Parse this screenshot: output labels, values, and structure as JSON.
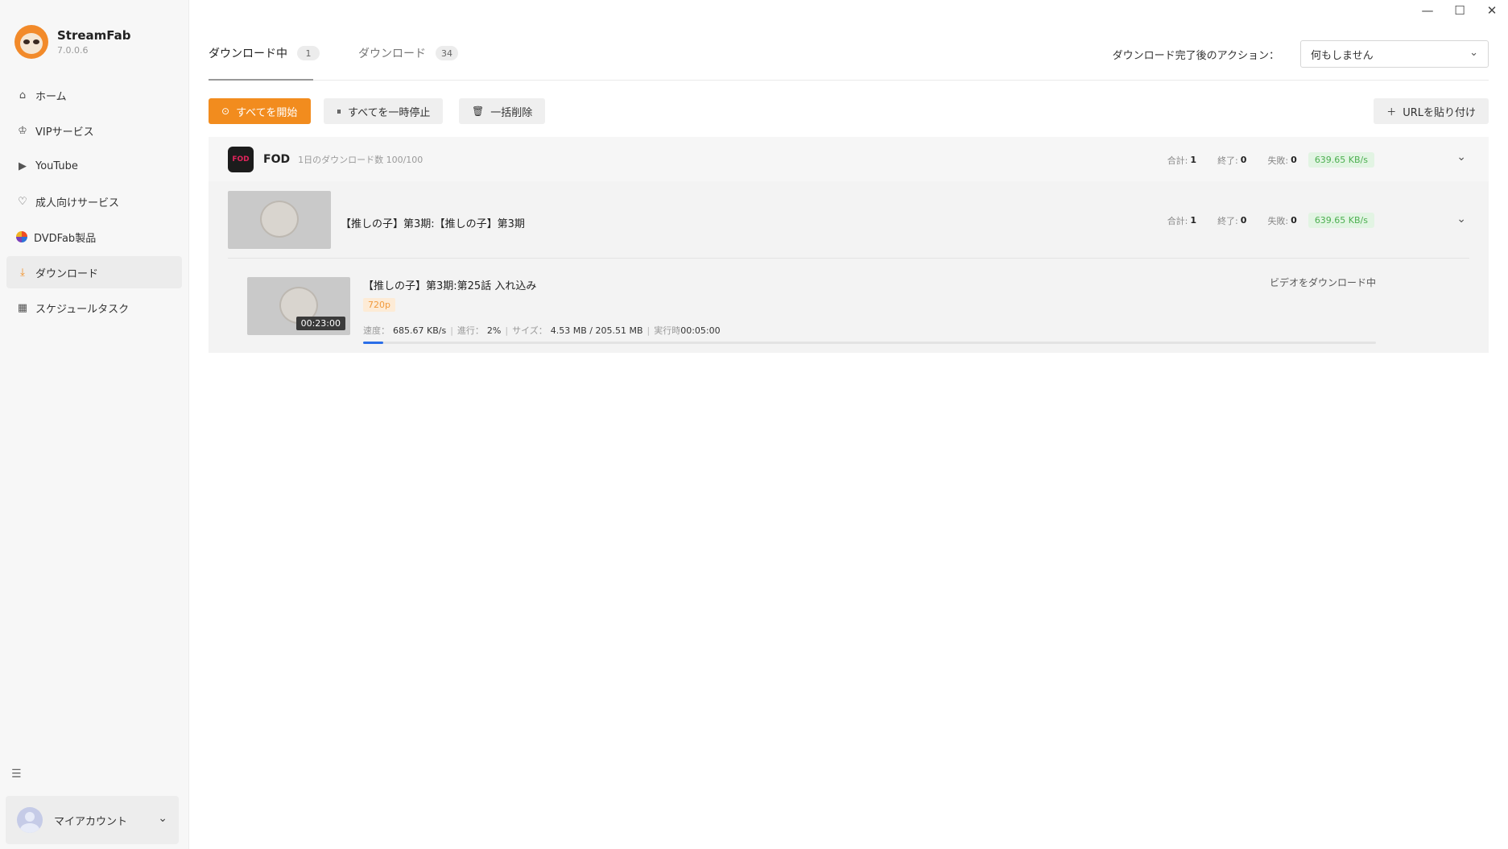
{
  "app": {
    "name": "StreamFab",
    "version": "7.0.0.6"
  },
  "sidebar": {
    "items": [
      {
        "label": "ホーム",
        "icon": "home-icon"
      },
      {
        "label": "VIPサービス",
        "icon": "vip-crown-icon"
      },
      {
        "label": "YouTube",
        "icon": "youtube-play-icon"
      },
      {
        "label": "成人向けサービス",
        "icon": "heart-icon"
      },
      {
        "label": "DVDFab製品",
        "icon": "dvdfab-logo-icon"
      },
      {
        "label": "ダウンロード",
        "icon": "download-icon",
        "active": true
      },
      {
        "label": "スケジュールタスク",
        "icon": "calendar-icon"
      }
    ],
    "account_label": "マイアカウント"
  },
  "tabs": [
    {
      "label": "ダウンロード中",
      "count": "1"
    },
    {
      "label": "ダウンロード",
      "count": "34"
    }
  ],
  "after_action": {
    "label": "ダウンロード完了後のアクション：",
    "value": "何もしません"
  },
  "toolbar": {
    "start_all": "すべてを開始",
    "pause_all": "すべてを一時停止",
    "delete_all": "一括削除",
    "paste_url": "URLを貼り付け"
  },
  "group": {
    "logo_text": "FOD",
    "name": "FOD",
    "limit": "1日のダウンロード数 100/100",
    "total_label": "合計:",
    "total": "1",
    "done_label": "終了:",
    "done": "0",
    "failed_label": "失敗:",
    "failed": "0",
    "speed": "639.65 KB/s"
  },
  "series": {
    "title": "【推しの子】第3期:【推しの子】第3期",
    "total_label": "合計:",
    "total": "1",
    "done_label": "終了:",
    "done": "0",
    "failed_label": "失敗:",
    "failed": "0",
    "speed": "639.65 KB/s"
  },
  "episode": {
    "title": "【推しの子】第3期:第25話 入れ込み",
    "quality": "720p",
    "duration": "00:23:00",
    "status": "ビデオをダウンロード中",
    "speed_label": "速度：",
    "speed": "685.67 KB/s",
    "progress_label": "進行：",
    "progress_text": "2%",
    "progress_value": 0.02,
    "size_label": "サイズ：",
    "size": "4.53 MB / 205.51 MB",
    "elapsed_label": "実行時",
    "elapsed": "00:05:00"
  },
  "colors": {
    "accent": "#f28c1e",
    "progress": "#2a6ee8",
    "speed_green": "#4caf50"
  }
}
